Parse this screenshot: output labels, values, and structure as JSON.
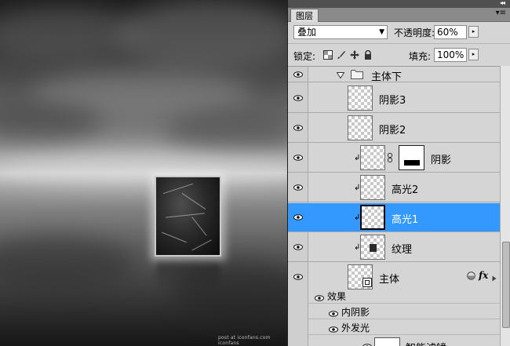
{
  "canvas": {
    "credit": "post at iconfans.com  iconfans"
  },
  "panel": {
    "tab_label": "图层",
    "collapse_glyph": "◂◂",
    "menu_glyph": "▾≡",
    "blend_mode": "叠加",
    "opacity_label": "不透明度:",
    "opacity_value": "60%",
    "lock_label": "锁定:",
    "fill_label": "填充:",
    "fill_value": "100%",
    "stepper_glyph": "▸",
    "dropdown_glyph": "▼"
  },
  "layers": {
    "group_name": "主体下",
    "shadow3": "阴影3",
    "shadow2": "阴影2",
    "shadow": "阴影",
    "highlight2": "高光2",
    "highlight1": "高光1",
    "texture": "纹理",
    "main": "主体",
    "effects": "效果",
    "inner_shadow": "内阴影",
    "outer_glow": "外发光",
    "smart_filters": "智能滤镜",
    "fx_label": "fx"
  },
  "colors": {
    "selection": "#3399ff",
    "panel_bg": "#d5d5d5"
  }
}
